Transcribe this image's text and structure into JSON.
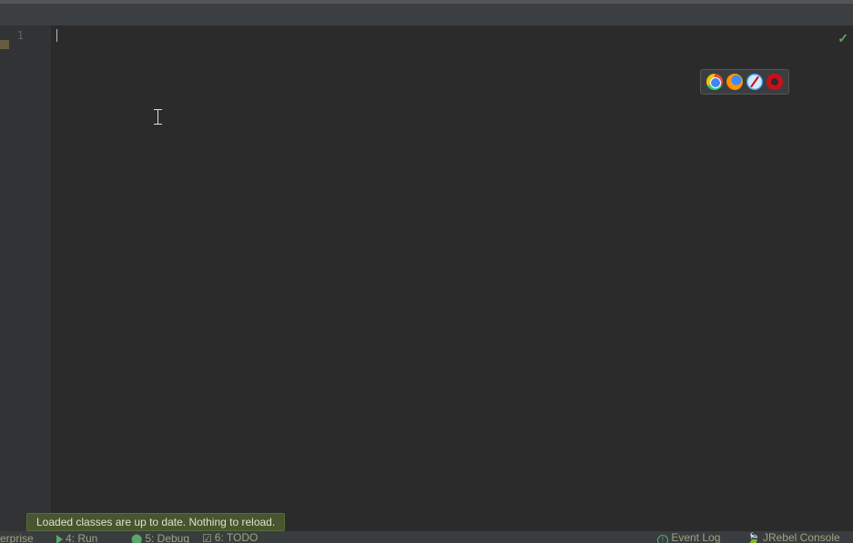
{
  "editor": {
    "line_number": "1"
  },
  "browser_icons": {
    "chrome": "chrome-icon",
    "firefox": "firefox-icon",
    "safari": "safari-icon",
    "opera": "opera-icon"
  },
  "status_indicator": {
    "check": "✓"
  },
  "tooltip": {
    "text": "Loaded classes are up to date. Nothing to reload."
  },
  "status_bar": {
    "item0": "erprise",
    "run": "4: Run",
    "debug": "5: Debug",
    "todo": "6: TODO",
    "event_log": "Event Log",
    "jrebel": "JRebel Console"
  }
}
